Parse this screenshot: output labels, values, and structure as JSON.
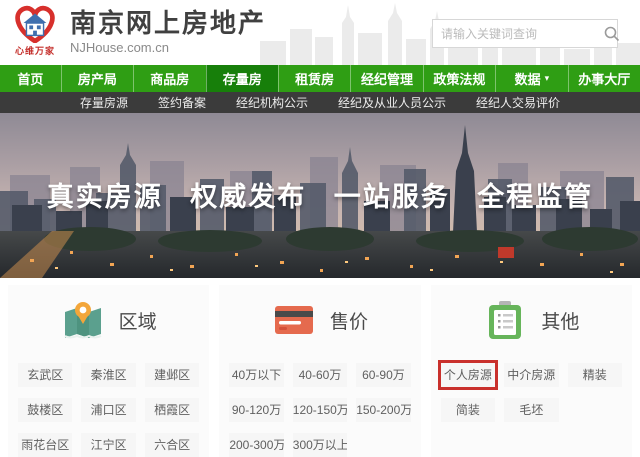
{
  "header": {
    "logo_slogan": "心维万家",
    "site_title": "南京网上房地产",
    "site_domain": "NJHouse.com.cn",
    "search_placeholder": "请输入关键词查询"
  },
  "nav": {
    "caret": "▾",
    "items": [
      {
        "label": "首页",
        "active": false
      },
      {
        "label": "房产局",
        "active": false
      },
      {
        "label": "商品房",
        "active": false
      },
      {
        "label": "存量房",
        "active": true
      },
      {
        "label": "租赁房",
        "active": false
      },
      {
        "label": "经纪管理",
        "active": false
      },
      {
        "label": "政策法规",
        "active": false
      },
      {
        "label": "数据",
        "active": false,
        "dropdown": true
      },
      {
        "label": "办事大厅",
        "active": false
      }
    ]
  },
  "subnav": {
    "items": [
      "存量房源",
      "签约备案",
      "经纪机构公示",
      "经纪及从业人员公示",
      "经纪人交易评价"
    ]
  },
  "hero": {
    "slogans": [
      "真实房源",
      "权威发布",
      "一站服务",
      "全程监管"
    ]
  },
  "filters": {
    "region": {
      "title": "区域",
      "icon": "map-icon",
      "options": [
        "玄武区",
        "秦淮区",
        "建邺区",
        "鼓楼区",
        "浦口区",
        "栖霞区",
        "雨花台区",
        "江宁区",
        "六合区"
      ]
    },
    "price": {
      "title": "售价",
      "icon": "price-card-icon",
      "options": [
        "40万以下",
        "40-60万",
        "60-90万",
        "90-120万",
        "120-150万",
        "150-200万",
        "200-300万",
        "300万以上"
      ]
    },
    "other": {
      "title": "其他",
      "icon": "clipboard-icon",
      "options": [
        "个人房源",
        "中介房源",
        "精装",
        "简装",
        "毛坯"
      ],
      "highlighted": "个人房源"
    }
  },
  "colors": {
    "nav_green": "#2f9e14",
    "nav_active_green": "#177f0a",
    "subnav_bg": "#3b3b3b",
    "logo_red": "#c5302c",
    "annotation_red": "#c9302c",
    "option_bg": "#f6f6f6"
  }
}
